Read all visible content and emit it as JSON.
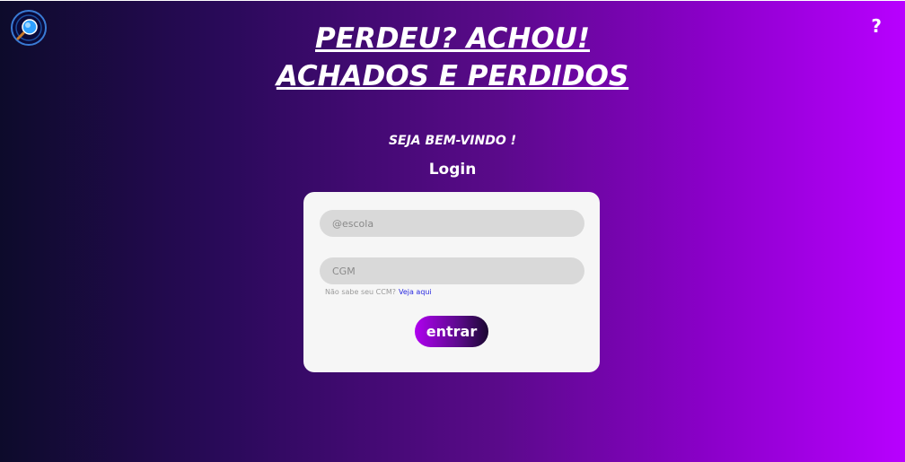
{
  "header": {
    "title_line1": "PERDEU? ACHOU!",
    "title_line2": "ACHADOS E PERDIDOS",
    "help_label": "?",
    "logo_icon": "magnifier-logo-icon"
  },
  "welcome": "SEJA BEM-VINDO !",
  "login": {
    "heading": "Login",
    "escola_placeholder": "@escola",
    "escola_value": "",
    "cgm_placeholder": "CGM",
    "cgm_value": "",
    "hint_text": "Não sabe seu CCM?",
    "hint_link": "Veja aqui",
    "submit_label": "entrar"
  },
  "colors": {
    "gradient_start": "#0d0b2b",
    "gradient_end": "#b800ff",
    "card_bg": "#f6f6f6",
    "input_bg": "#d9d9d9",
    "link": "#2a2ae0"
  }
}
